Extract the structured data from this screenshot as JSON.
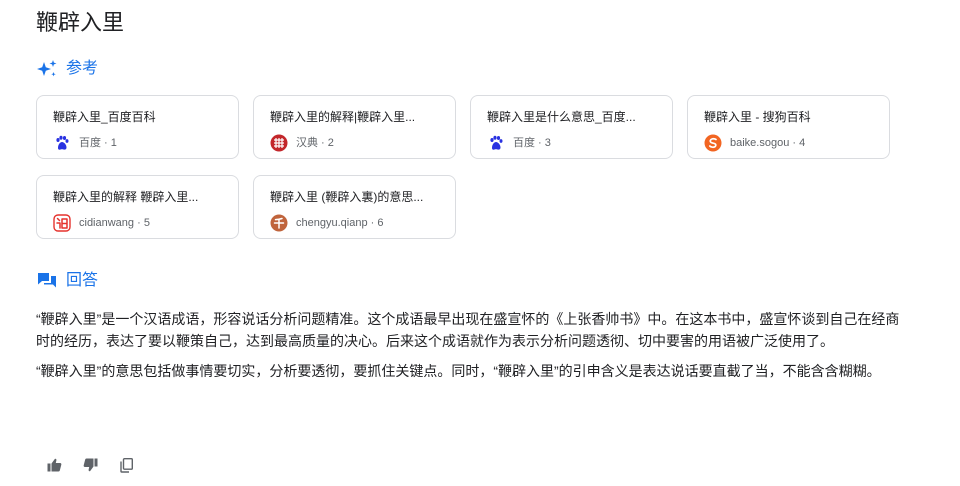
{
  "title": "鞭辟入里",
  "references": {
    "heading": "参考",
    "items": [
      {
        "title": "鞭辟入里_百度百科",
        "source": "百度 · 1",
        "icon": "baidu-paw-icon"
      },
      {
        "title": "鞭辟入里的解释|鞭辟入里...",
        "source": "汉典 · 2",
        "icon": "zdic-icon"
      },
      {
        "title": "鞭辟入里是什么意思_百度...",
        "source": "百度 · 3",
        "icon": "baidu-paw-icon"
      },
      {
        "title": "鞭辟入里 - 搜狗百科",
        "source": "baike.sogou · 4",
        "icon": "sogou-icon"
      },
      {
        "title": "鞭辟入里的解释 鞭辟入里...",
        "source": "cidianwang · 5",
        "icon": "cidianwang-icon"
      },
      {
        "title": "鞭辟入里 (鞭辟入裏)的意思...",
        "source": "chengyu.qianp · 6",
        "icon": "qianp-icon"
      }
    ]
  },
  "answer": {
    "heading": "回答",
    "paragraphs": [
      "“鞭辟入里”是一个汉语成语，形容说话分析问题精准。这个成语最早出现在盛宣怀的《上张香帅书》中。在这本书中，盛宣怀谈到自己在经商时的经历，表达了要以鞭策自己，达到最高质量的决心。后来这个成语就作为表示分析问题透彻、切中要害的用语被广泛使用了。",
      "“鞭辟入里”的意思包括做事情要切实，分析要透彻，要抓住关键点。同时，“鞭辟入里”的引申含义是表达说话要直截了当，不能含含糊糊。"
    ]
  },
  "colors": {
    "accent": "#1a73e8",
    "baidu": "#2932e1",
    "zdic": "#c3272b",
    "sogou": "#f26522",
    "cidianwang": "#e5322d",
    "qianp": "#c0643c"
  },
  "actions": [
    "thumbs-up-icon",
    "thumbs-down-icon",
    "copy-icon"
  ]
}
